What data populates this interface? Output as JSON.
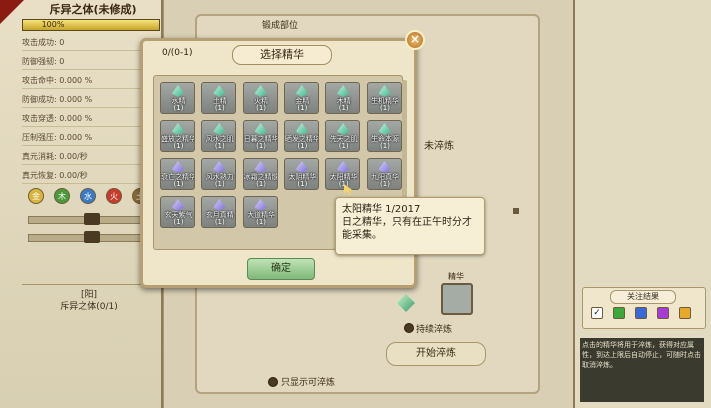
{
  "left": {
    "title": "斥异之体(未修成)",
    "progress_label": "100%",
    "progress_fraction": 1.0,
    "stats": [
      "攻击成功: 0",
      "防御强韧: 0",
      "攻击命中: 0.000 %",
      "防御成功: 0.000 %",
      "攻击穿透: 0.000 %",
      "压制强压: 0.000 %",
      "真元消耗: 0.00/秒",
      "真元恢复: 0.00/秒"
    ],
    "elements": [
      "金",
      "木",
      "水",
      "火",
      "土"
    ],
    "element_colors": [
      "#d8b43a",
      "#4a9a3a",
      "#3a7ac8",
      "#c83a2a",
      "#8a6a3a"
    ],
    "bottom_tag": "[阳]",
    "bottom_text": "斥异之体(0/1)"
  },
  "main": {
    "top_label": "锻成部位",
    "side_label": "未淬炼",
    "essence_label": "精华",
    "keep_label": "持续淬炼",
    "start_button": "开始淬炼",
    "filter_label": "只显示可淬炼"
  },
  "dialog": {
    "counter": "0/(0-1)",
    "title": "选择精华",
    "confirm": "确定",
    "close_glyph": "×",
    "items": [
      {
        "name": "水精",
        "count": "(1)",
        "color": "green"
      },
      {
        "name": "土精",
        "count": "(1)",
        "color": "green"
      },
      {
        "name": "火精",
        "count": "(1)",
        "color": "green"
      },
      {
        "name": "金精",
        "count": "(1)",
        "color": "green"
      },
      {
        "name": "木精",
        "count": "(1)",
        "color": "green"
      },
      {
        "name": "生机精华",
        "count": "(1)",
        "color": "green"
      },
      {
        "name": "盛放之精华",
        "count": "(1)",
        "color": "green"
      },
      {
        "name": "风水之肌",
        "count": "(1)",
        "color": "green"
      },
      {
        "name": "日暮之精华",
        "count": "(1)",
        "color": "green"
      },
      {
        "name": "晒发之精华",
        "count": "(1)",
        "color": "green"
      },
      {
        "name": "先天之肌",
        "count": "(1)",
        "color": "green"
      },
      {
        "name": "生命本源",
        "count": "(1)",
        "color": "green"
      },
      {
        "name": "衰亡之精华",
        "count": "(1)",
        "color": "purple"
      },
      {
        "name": "风水熟力",
        "count": "(1)",
        "color": "purple"
      },
      {
        "name": "冰霜之精髓",
        "count": "(1)",
        "color": "purple"
      },
      {
        "name": "太阴精华",
        "count": "(1)",
        "color": "purple"
      },
      {
        "name": "太阳精华",
        "count": "(1)",
        "color": "purple"
      },
      {
        "name": "九阳真华",
        "count": "(1)",
        "color": "purple"
      },
      {
        "name": "玄天紫气",
        "count": "(1)",
        "color": "purple"
      },
      {
        "name": "玄月真精",
        "count": "(1)",
        "color": "purple"
      },
      {
        "name": "大道精华",
        "count": "(1)",
        "color": "purple"
      }
    ]
  },
  "tooltip": {
    "title": "太阳精华 1/2017",
    "desc": "日之精华，只有在正午时分才能采集。"
  },
  "right": {
    "focus_title": "关注结果",
    "focus_colors": [
      "#ffffff",
      "#3aa83a",
      "#3a6ad8",
      "#a83ad8",
      "#e8a82a"
    ],
    "note": "点击的精华将用于淬炼，获得对应属性，到达上限后自动停止，可随时点击取消淬炼。"
  }
}
